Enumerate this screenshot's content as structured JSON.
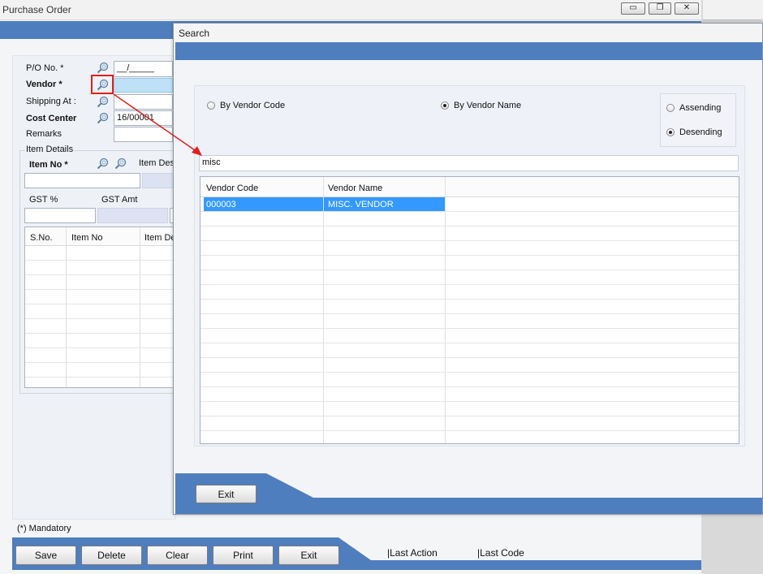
{
  "main_window": {
    "title": "Purchase Order",
    "form": {
      "po_no_label": "P/O No. *",
      "po_no_value": "__/_____",
      "vendor_label": "Vendor *",
      "shipping_label": "Shipping At :",
      "cost_center_label": "Cost Center",
      "cost_center_value": "16/00001",
      "remarks_label": "Remarks"
    },
    "item_details": {
      "group_label": "Item Details",
      "item_no_label": "Item No *",
      "item_desc_label": "Item Des",
      "gst_pct_label": "GST %",
      "gst_amt_label": "GST Amt"
    },
    "items_table": {
      "columns": [
        "S.No.",
        "Item No",
        "Item De"
      ]
    },
    "mandatory_note": "(*) Mandatory",
    "buttons": {
      "save": "Save",
      "delete": "Delete",
      "clear": "Clear",
      "print": "Print",
      "exit": "Exit"
    },
    "status": {
      "last_action": "|Last Action",
      "last_code": "|Last Code"
    },
    "window_controls": {
      "minimize": "▭",
      "restore": "❐",
      "close": "✕"
    }
  },
  "search_dialog": {
    "title": "Search",
    "radio_by_code": "By Vendor Code",
    "radio_by_name": "By Vendor Name",
    "selected_search_by": "By Vendor Name",
    "sort_ascending": "Assending",
    "sort_descending": "Desending",
    "selected_sort": "Desending",
    "search_value": "misc",
    "columns": [
      "Vendor Code",
      "Vendor Name"
    ],
    "rows": [
      {
        "code": "000003",
        "name": "MISC. VENDOR"
      }
    ],
    "exit_button": "Exit"
  },
  "colors": {
    "band_blue": "#4f7ebf",
    "selection_blue": "#3399ff",
    "annotation_red": "#e02020",
    "panel_bg": "#f0f2f7"
  },
  "icons": {
    "lookup": "magnifier-search-icon"
  }
}
